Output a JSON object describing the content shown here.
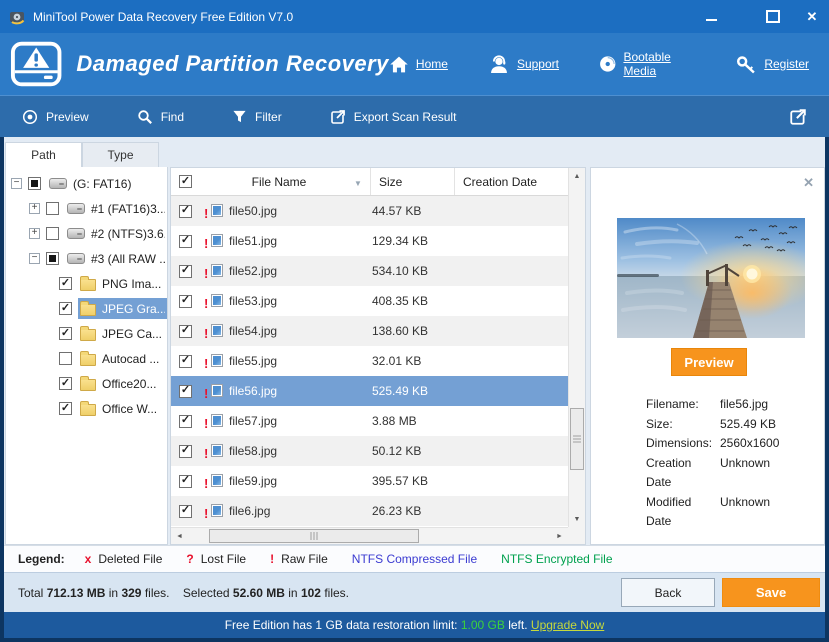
{
  "window": {
    "title": "MiniTool Power Data Recovery Free Edition V7.0"
  },
  "header": {
    "title": "Damaged Partition Recovery",
    "nav": [
      {
        "label": "Home"
      },
      {
        "label": "Support"
      },
      {
        "label": "Bootable Media"
      },
      {
        "label": "Register"
      }
    ]
  },
  "toolbar": {
    "items": [
      {
        "label": "Preview"
      },
      {
        "label": "Find"
      },
      {
        "label": "Filter"
      },
      {
        "label": "Export Scan Result"
      }
    ]
  },
  "sidebar": {
    "tabs": [
      {
        "label": "Path"
      },
      {
        "label": "Type"
      }
    ],
    "tree": [
      {
        "label": "(G: FAT16)",
        "check": "partial",
        "icon": "drive"
      },
      {
        "label": "#1 (FAT16)3....",
        "check": "unchecked",
        "icon": "drive"
      },
      {
        "label": "#2 (NTFS)3.6...",
        "check": "unchecked",
        "icon": "drive"
      },
      {
        "label": "#3 (All RAW ...",
        "check": "partial",
        "icon": "drive"
      },
      {
        "label": "PNG Ima...",
        "check": "checked",
        "icon": "folder"
      },
      {
        "label": "JPEG Gra...",
        "check": "checked",
        "icon": "folder",
        "selected": true
      },
      {
        "label": "JPEG Ca...",
        "check": "checked",
        "icon": "folder"
      },
      {
        "label": "Autocad ...",
        "check": "unchecked",
        "icon": "folder"
      },
      {
        "label": "Office20...",
        "check": "checked",
        "icon": "folder"
      },
      {
        "label": "Office W...",
        "check": "checked",
        "icon": "folder"
      }
    ]
  },
  "file_list": {
    "columns": {
      "name": "File Name",
      "size": "Size",
      "created": "Creation Date"
    },
    "rows": [
      {
        "name": "file50.jpg",
        "size": "44.57 KB"
      },
      {
        "name": "file51.jpg",
        "size": "129.34 KB"
      },
      {
        "name": "file52.jpg",
        "size": "534.10 KB"
      },
      {
        "name": "file53.jpg",
        "size": "408.35 KB"
      },
      {
        "name": "file54.jpg",
        "size": "138.60 KB"
      },
      {
        "name": "file55.jpg",
        "size": "32.01 KB"
      },
      {
        "name": "file56.jpg",
        "size": "525.49 KB",
        "selected": true
      },
      {
        "name": "file57.jpg",
        "size": "3.88 MB"
      },
      {
        "name": "file58.jpg",
        "size": "50.12 KB"
      },
      {
        "name": "file59.jpg",
        "size": "395.57 KB"
      },
      {
        "name": "file6.jpg",
        "size": "26.23 KB"
      }
    ]
  },
  "preview": {
    "button_label": "Preview",
    "details": [
      {
        "label": "Filename:",
        "value": "file56.jpg"
      },
      {
        "label": "Size:",
        "value": "525.49 KB"
      },
      {
        "label": "Dimensions:",
        "value": "2560x1600"
      },
      {
        "label": "Creation Date",
        "value": "Unknown"
      },
      {
        "label": "Modified Date",
        "value": "Unknown"
      }
    ]
  },
  "legend": {
    "title": "Legend:",
    "items": [
      {
        "symbol": "x",
        "label": "Deleted File"
      },
      {
        "symbol": "?",
        "label": "Lost File"
      },
      {
        "symbol": "!",
        "label": "Raw File"
      },
      {
        "symbol": "",
        "label": "NTFS Compressed File"
      },
      {
        "symbol": "",
        "label": "NTFS Encrypted File"
      }
    ]
  },
  "status": {
    "total_prefix": "Total",
    "total_size": "712.13 MB",
    "total_mid": "in",
    "total_count": "329",
    "total_suffix": "files.",
    "selected_prefix": "Selected",
    "selected_size": "52.60 MB",
    "selected_mid": "in",
    "selected_count": "102",
    "selected_suffix": "files.",
    "back_label": "Back",
    "save_label": "Save"
  },
  "footer": {
    "prefix": "Free Edition has 1 GB data restoration limit:",
    "remaining": "1.00 GB",
    "middle": "left.",
    "link": "Upgrade Now"
  },
  "colors": {
    "titlebar_blue": "#1c6ec1",
    "header_blue": "#2d7bc7",
    "toolbar_blue": "#2d6cab",
    "selection_blue": "#74a0d4",
    "accent_orange": "#f7941d",
    "legend_red": "#e8112d",
    "ntfs_compressed_blue": "#3b3bd1",
    "ntfs_encrypted_green": "#00a14e",
    "footer_green": "#3cd23c",
    "footer_link_yellow": "#c6d93c"
  }
}
